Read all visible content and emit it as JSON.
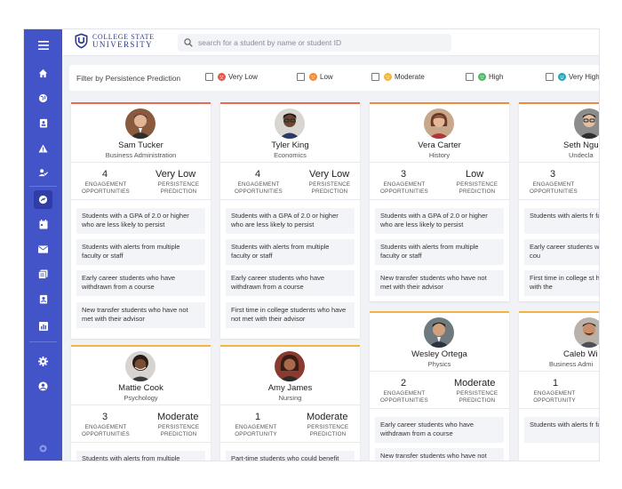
{
  "university": {
    "line1": "COLLEGE STATE",
    "line2": "UNIVERSITY"
  },
  "search": {
    "placeholder": "search for a student by name or student ID"
  },
  "filter": {
    "label": "Filter by Persistence Prediction",
    "options": [
      {
        "label": "Very Low",
        "color": "#e2594b"
      },
      {
        "label": "Low",
        "color": "#ef8b3a"
      },
      {
        "label": "Moderate",
        "color": "#f2b541"
      },
      {
        "label": "High",
        "color": "#54b86a"
      },
      {
        "label": "Very High",
        "color": "#2aa6b8"
      }
    ]
  },
  "stat_labels": {
    "engagement": [
      "ENGAGEMENT",
      "OPPORTUNITIES"
    ],
    "engagement_singular": [
      "ENGAGEMENT",
      "OPPORTUNITY"
    ],
    "persistence": [
      "PERSISTENCE",
      "PREDICTION"
    ]
  },
  "cards": [
    {
      "name": "Sam Tucker",
      "major": "Business Administration",
      "count": "4",
      "prediction": "Very Low",
      "alerts": [
        "Students with a GPA of 2.0 or higher who are less likely to persist",
        "Students with alerts from multiple faculty or staff",
        "Early career students who have withdrawn from a course",
        "New transfer students who have not met with their advisor"
      ]
    },
    {
      "name": "Tyler King",
      "major": "Economics",
      "count": "4",
      "prediction": "Very Low",
      "alerts": [
        "Students with a GPA of 2.0 or higher who are less likely to persist",
        "Students with alerts from multiple faculty or staff",
        "Early career students who have withdrawn from a course",
        "First time in college students who have not met with their advisor"
      ]
    },
    {
      "name": "Vera Carter",
      "major": "History",
      "count": "3",
      "prediction": "Low",
      "alerts": [
        "Students with a GPA of 2.0 or higher who are less likely to persist",
        "Students with alerts from multiple faculty or staff",
        "New transfer students who have not met with their advisor"
      ]
    },
    {
      "name": "Seth Ngu",
      "major": "Undecla",
      "count": "3",
      "prediction": "",
      "alerts": [
        "Students with alerts fr faculty or staff",
        "Early career students withdrawn from a cou",
        "First time in college st have not met with the"
      ]
    },
    {
      "name": "Mattie Cook",
      "major": "Psychology",
      "count": "3",
      "prediction": "Moderate",
      "alerts": [
        "Students with alerts from multiple"
      ]
    },
    {
      "name": "Amy James",
      "major": "Nursing",
      "count": "1",
      "prediction": "Moderate",
      "alerts": [
        "Part-time students who could benefit"
      ]
    },
    {
      "name": "Wesley Ortega",
      "major": "Physics",
      "count": "2",
      "prediction": "Moderate",
      "alerts": [
        "Early career students who have withdrawn from a course",
        "New transfer students who have not"
      ]
    },
    {
      "name": "Caleb Wi",
      "major": "Business Admi",
      "count": "1",
      "prediction": "",
      "alerts": [
        "Students with alerts fr faculty or staff"
      ]
    }
  ]
}
